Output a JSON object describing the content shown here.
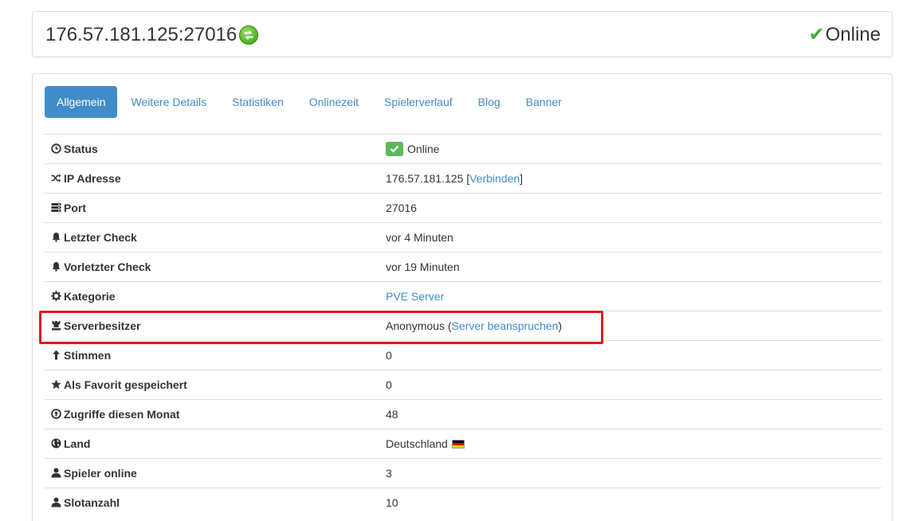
{
  "header": {
    "address": "176.57.181.125:27016",
    "status_label": "Online",
    "status_color": "#3cb034"
  },
  "tabs": [
    {
      "label": "Allgemein",
      "active": true
    },
    {
      "label": "Weitere Details"
    },
    {
      "label": "Statistiken"
    },
    {
      "label": "Onlinezeit"
    },
    {
      "label": "Spielerverlauf"
    },
    {
      "label": "Blog"
    },
    {
      "label": "Banner"
    }
  ],
  "rows": {
    "status": {
      "icon": "clock-icon",
      "label": "Status",
      "value": "Online"
    },
    "ip": {
      "icon": "shuffle-icon",
      "label": "IP Adresse",
      "value": "176.57.181.125",
      "link_open": "[",
      "link": "Verbinden",
      "link_close": "]"
    },
    "port": {
      "icon": "server-icon",
      "label": "Port",
      "value": "27016"
    },
    "last_check": {
      "icon": "bell-icon",
      "label": "Letzter Check",
      "value": "vor 4 Minuten"
    },
    "prev_check": {
      "icon": "bell-icon",
      "label": "Vorletzter Check",
      "value": "vor 19 Minuten"
    },
    "category": {
      "icon": "cog-icon",
      "label": "Kategorie",
      "link": "PVE Server"
    },
    "owner": {
      "icon": "tower-icon",
      "label": "Serverbesitzer",
      "value": "Anonymous",
      "link_open": "(",
      "link": "Server beanspruchen",
      "link_close": ")"
    },
    "votes": {
      "icon": "arrow-up-icon",
      "label": "Stimmen",
      "value": "0"
    },
    "favorites": {
      "icon": "star-icon",
      "label": "Als Favorit gespeichert",
      "value": "0"
    },
    "hits": {
      "icon": "circle-arrow-up-icon",
      "label": "Zugriffe diesen Monat",
      "value": "48"
    },
    "country": {
      "icon": "globe-icon",
      "label": "Land",
      "value": "Deutschland",
      "flag": "germany-flag-icon"
    },
    "players": {
      "icon": "user-icon",
      "label": "Spieler online",
      "value": "3"
    },
    "slots": {
      "icon": "user-icon",
      "label": "Slotanzahl",
      "value": "10"
    }
  },
  "colors": {
    "accent": "#428bca",
    "success": "#5cb85c",
    "highlight": "#e01b1b"
  }
}
